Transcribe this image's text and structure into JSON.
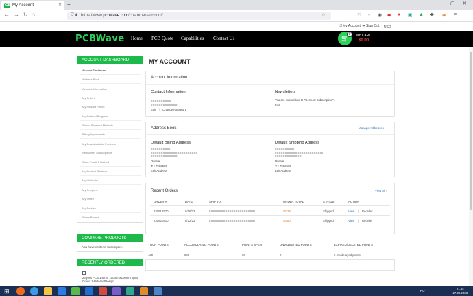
{
  "browser": {
    "tab_title": "My Account",
    "favicon": "PCB",
    "url_prefix": "https://www.",
    "url_domain": "pcbwave.com",
    "url_path": "/customer/account/"
  },
  "topbar": {
    "my_account": "My Account",
    "sign_out": "Sign Out",
    "currency": "USD"
  },
  "header": {
    "logo": "PCBWave",
    "menu": [
      "Home",
      "PCB Quote",
      "Capabilities",
      "Contact Us"
    ],
    "cart_count": "0",
    "cart_label": "MY CART",
    "cart_total": "$0.00"
  },
  "sidebar": {
    "title": "ACCOUNT DASHBOARD",
    "items": [
      "Account Dashboard",
      "Address Book",
      "Account Information",
      "My Orders",
      "My Reward Points",
      "My Referral Program",
      "Stored Payment Methods",
      "Billing Agreements",
      "My Downloadable Products",
      "Newsletter Subscriptions",
      "Store Credit & Refund",
      "My Product Reviews",
      "My Wish List",
      "My Coupons",
      "My Share",
      "My Review",
      "Share Project"
    ],
    "compare_title": "COMPARE PRODUCTS",
    "compare_text": "You have no items to compare.",
    "recent_title": "RECENTLY ORDERED",
    "recent_item": "2layers PCB 1.6mm 100mmX100mm 5pcs Green 1-DifferentDesign"
  },
  "page_title": "MY ACCOUNT",
  "account_info": {
    "heading": "Account Information",
    "contact_title": "Contact Information",
    "edit": "Edit",
    "change_password": "Change Password",
    "newsletters_title": "Newsletters",
    "newsletters_text": "You are subscribed to \"General Subscription\".",
    "newsletters_edit": "Edit"
  },
  "address_book": {
    "heading": "Address Book",
    "manage": "Manage Addresses",
    "billing_title": "Default Billing Address",
    "billing_country": "Russia",
    "billing_phone": "T: +7982505",
    "billing_edit": "Edit Address",
    "shipping_title": "Default Shipping Address",
    "shipping_country": "Russia",
    "shipping_phone": "T: +7982505",
    "shipping_edit": "Edit Address"
  },
  "recent_orders": {
    "heading": "Recent Orders",
    "view_all": "View All",
    "columns": [
      "ORDER #",
      "DATE",
      "SHIP TO",
      "ORDER TOTAL",
      "STATUS",
      "ACTION"
    ],
    "rows": [
      {
        "order": "230912570",
        "date": "9/16/23",
        "total": "$5.29",
        "status": "Shipped",
        "view": "View",
        "reorder": "Reorder"
      },
      {
        "order": "230820510",
        "date": "8/22/23",
        "total": "$4.80",
        "status": "Shipped",
        "view": "View",
        "reorder": "Reorder"
      }
    ]
  },
  "points": {
    "columns": [
      "YOUR POINTS",
      "ACCUMULATED POINTS",
      "POINTS SPENT",
      "UNVALIDATED POINTS",
      "EXPIRED/DELAYED POINTS"
    ],
    "values": [
      "420",
      "500",
      "80",
      "2",
      "0 (no delayed points)"
    ]
  },
  "taskbar": {
    "lang": "RU",
    "time": "21:44",
    "date": "27.09.2023"
  },
  "colors": {
    "accent_green": "#1db94a",
    "header_bg": "#000000",
    "price": "#e07a20",
    "link": "#2a74b8"
  }
}
